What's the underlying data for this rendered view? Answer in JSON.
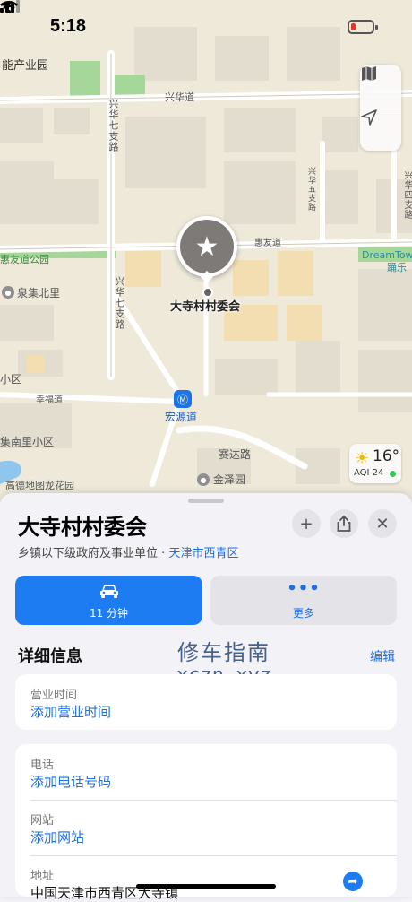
{
  "status_bar": {
    "time": "5:18"
  },
  "map": {
    "labels": {
      "park_top": "能产业园",
      "xinghua_road_top": "兴华道",
      "xinghua_seventh_branch_top": "兴华七支路",
      "xinghua_fifth_branch": "兴华五支路",
      "xinghua_fourth_branch": "兴华四支路",
      "huiyou_road": "惠友道",
      "huiyou_park": "惠友道公园",
      "dreamtown_en": "DreamTow",
      "dreamtown_cn": "踊乐",
      "quanji_north": "泉集北里",
      "xinghua_seventh_branch_mid": "兴华七支路",
      "xiaoqu": "小区",
      "xingfu_road": "幸福道",
      "hongyuan_road": "宏源道",
      "quanji_south": "集南里小区",
      "saida_road": "赛达路",
      "jinze_garden": "金泽园",
      "longhua_garden": "高德地图龙花园"
    },
    "pin_label": "大寺村村委会",
    "weather": {
      "temp": "16°",
      "aqi": "AQI 24"
    },
    "colors": {
      "land": "#efe9da",
      "road": "#ffffff",
      "building": "#e3ddd0",
      "park": "#9fd48a",
      "water": "#8ec6ee"
    }
  },
  "place": {
    "title": "大寺村村委会",
    "category": "乡镇以下级政府及事业单位",
    "separator": "·",
    "location_link": "天津市西青区"
  },
  "actions": {
    "route_time": "11 分钟",
    "more_dots": "•••",
    "more_label": "更多"
  },
  "details": {
    "section_title": "详细信息",
    "edit_label": "编辑",
    "hours_label": "营业时间",
    "hours_value": "添加营业时间",
    "phone_label": "电话",
    "phone_value": "添加电话号码",
    "website_label": "网站",
    "website_value": "添加网站",
    "address_label": "地址",
    "address_value": "中国天津市西青区大寺镇"
  },
  "watermark": {
    "line1": "修车指南",
    "line2": "xczn.xyz"
  }
}
